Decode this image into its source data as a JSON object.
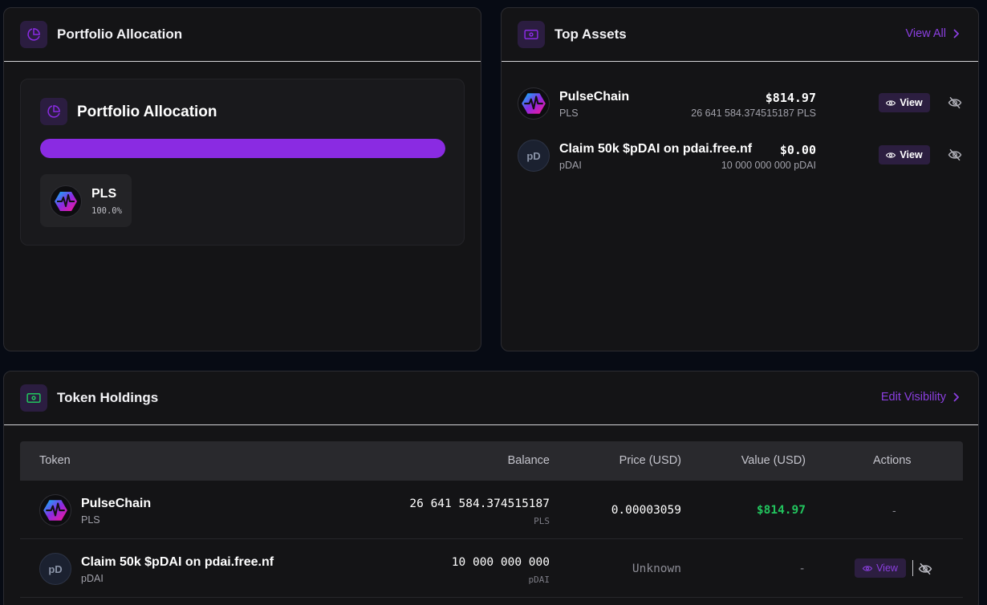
{
  "colors": {
    "accent": "#8a2be2",
    "positive": "#22c55e",
    "background": "#070b14",
    "card": "#141416"
  },
  "allocation": {
    "header_title": "Portfolio Allocation",
    "inner_title": "Portfolio Allocation",
    "bar_fraction": 1.0,
    "items": [
      {
        "symbol": "PLS",
        "percent": "100.0%",
        "icon": "pulsechain-logo"
      }
    ]
  },
  "top_assets": {
    "title": "Top Assets",
    "view_all": "View All",
    "assets": [
      {
        "name": "PulseChain",
        "symbol": "PLS",
        "value": "$814.97",
        "balance": "26 641 584.374515187 PLS",
        "view_label": "View",
        "icon": "pulsechain-logo"
      },
      {
        "name": "Claim 50k $pDAI on pdai.free.nf",
        "symbol": "pDAI",
        "value": "$0.00",
        "balance": "10 000 000 000 pDAI",
        "view_label": "View",
        "icon_text": "pD"
      }
    ]
  },
  "holdings": {
    "title": "Token Holdings",
    "edit_visibility": "Edit Visibility",
    "columns": [
      "Token",
      "Balance",
      "Price (USD)",
      "Value (USD)",
      "Actions"
    ],
    "rows": [
      {
        "name": "PulseChain",
        "symbol": "PLS",
        "balance": "26 641 584.374515187",
        "balance_symbol": "PLS",
        "price": "0.00003059",
        "value": "$814.97",
        "action": "-"
      },
      {
        "name": "Claim 50k $pDAI on pdai.free.nf",
        "symbol": "pDAI",
        "icon_text": "pD",
        "balance": "10 000 000 000",
        "balance_symbol": "pDAI",
        "price": "Unknown",
        "value": "-",
        "view_label": "View"
      }
    ]
  }
}
